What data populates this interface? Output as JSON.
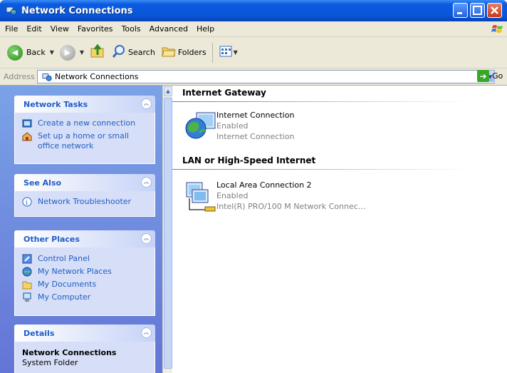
{
  "window": {
    "title": "Network Connections"
  },
  "menu": [
    "File",
    "Edit",
    "View",
    "Favorites",
    "Tools",
    "Advanced",
    "Help"
  ],
  "toolbar": {
    "back_label": "Back",
    "search_label": "Search",
    "folders_label": "Folders"
  },
  "address": {
    "label": "Address",
    "value": "Network Connections",
    "go_label": "Go"
  },
  "left_pane": {
    "network_tasks": {
      "title": "Network Tasks",
      "items": [
        "Create a new connection",
        "Set up a home or small office network"
      ]
    },
    "see_also": {
      "title": "See Also",
      "items": [
        "Network Troubleshooter"
      ]
    },
    "other_places": {
      "title": "Other Places",
      "items": [
        "Control Panel",
        "My Network Places",
        "My Documents",
        "My Computer"
      ]
    },
    "details": {
      "title": "Details",
      "name": "Network Connections",
      "type": "System Folder"
    }
  },
  "content": {
    "groups": [
      {
        "title": "Internet Gateway",
        "items": [
          {
            "name": "Internet Connection",
            "status": "Enabled",
            "device": "Internet Connection"
          }
        ]
      },
      {
        "title": "LAN or High-Speed Internet",
        "items": [
          {
            "name": "Local Area Connection 2",
            "status": "Enabled",
            "device": "Intel(R) PRO/100 M Network Connec..."
          }
        ]
      }
    ]
  },
  "colors": {
    "title_blue": "#0a58d8",
    "task_link": "#215dc6",
    "pane_blue": "#6375d6"
  }
}
